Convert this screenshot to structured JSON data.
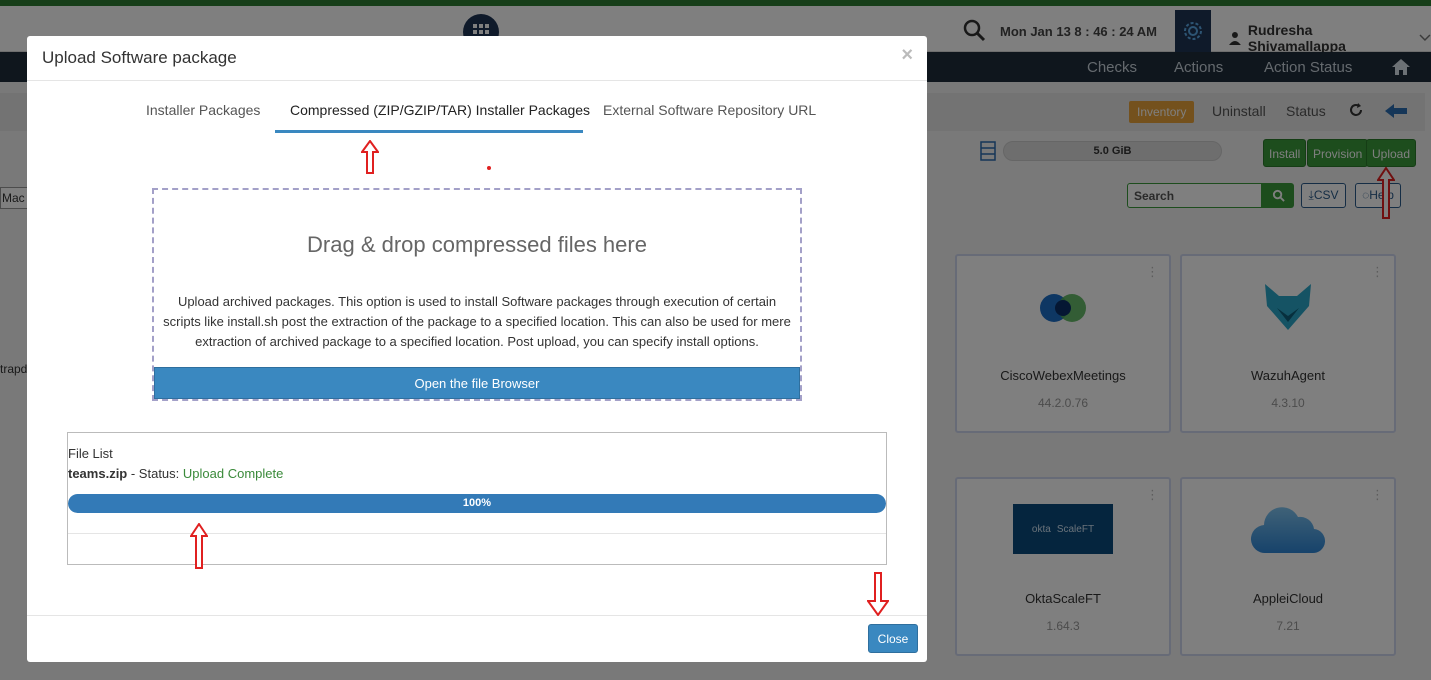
{
  "topbar": {
    "datetime": "Mon Jan 13  8 : 46 : 24  AM",
    "user_name": "Rudresha Shivamallappa"
  },
  "nav": {
    "items": [
      "Checks",
      "Actions",
      "Action Status"
    ]
  },
  "subbar": {
    "inventory_badge": "Inventory",
    "uninstall": "Uninstall",
    "status": "Status"
  },
  "disk": {
    "label": "5.0 GiB"
  },
  "actions": {
    "install": "Install",
    "provision": "Provision",
    "upload": "Upload"
  },
  "search": {
    "placeholder": "Search",
    "csv": "CSV",
    "help": "Help"
  },
  "left_fragments": {
    "mac": "Mac",
    "partial": "trapd"
  },
  "cards": [
    {
      "name": "CiscoWebexMeetings",
      "version": "44.2.0.76"
    },
    {
      "name": "WazuhAgent",
      "version": "4.3.10"
    },
    {
      "name": "OktaScaleFT",
      "version": "1.64.3",
      "logo_text_a": "okta",
      "logo_text_b": "ScaleFT"
    },
    {
      "name": "AppleiCloud",
      "version": "7.21"
    }
  ],
  "modal": {
    "title": "Upload Software package",
    "close_x": "×",
    "tabs": [
      {
        "label": "Installer Packages"
      },
      {
        "label": "Compressed (ZIP/GZIP/TAR) Installer Packages"
      },
      {
        "label": "External Software Repository URL"
      }
    ],
    "dropzone": {
      "title": "Drag & drop compressed files here",
      "description": "Upload archived packages. This option is used to install Software packages through execution of certain scripts like install.sh post the extraction of the package to a specified location. This can also be used for mere extraction of archived package to a specified location. Post upload, you can specify install options.",
      "button": "Open the file Browser"
    },
    "file_list": {
      "title": "File List",
      "file_name": "teams.zip",
      "status_prefix": " - Status: ",
      "status": "Upload Complete",
      "progress_label": "100%",
      "progress": 1.0
    },
    "close_button": "Close"
  },
  "colors": {
    "accent": "#3a88c0",
    "success": "#3a9b3a",
    "navbar": "#1f2d3a",
    "annotation": "#e02020"
  }
}
